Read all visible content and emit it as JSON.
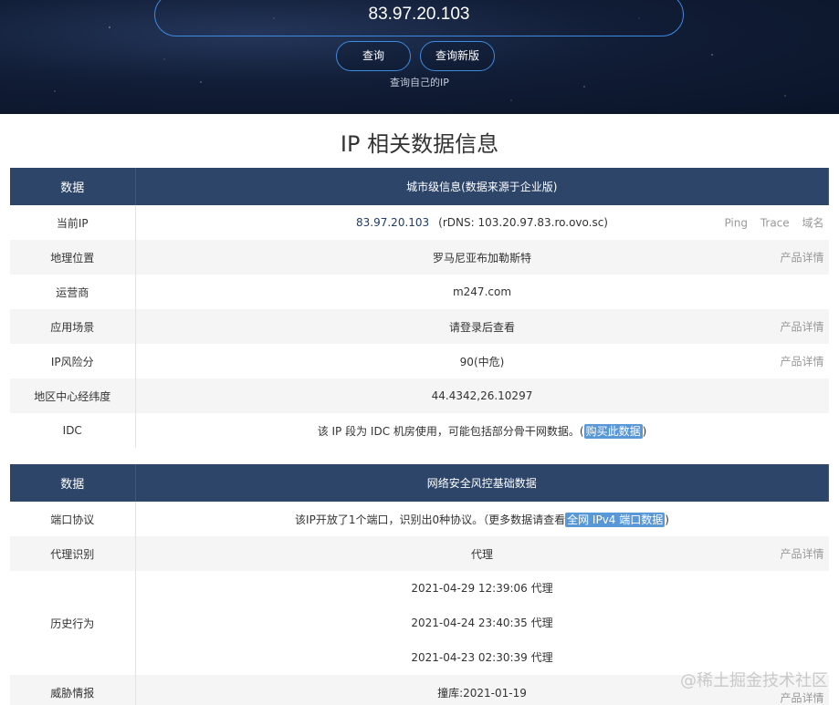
{
  "hero": {
    "ip_value": "83.97.20.103",
    "query_label": "查询",
    "query_new_label": "查询新版",
    "self_link": "查询自己的IP"
  },
  "title": "IP 相关数据信息",
  "table1": {
    "header": {
      "col1": "数据",
      "col2": "城市级信息(数据来源于企业版)"
    },
    "current_ip": {
      "label": "当前IP",
      "ip": "83.97.20.103",
      "rdns": "(rDNS: 103.20.97.83.ro.ovo.sc)",
      "links": [
        "Ping",
        "Trace",
        "域名"
      ]
    },
    "location": {
      "label": "地理位置",
      "value": "罗马尼亚布加勒斯特",
      "link": "产品详情"
    },
    "isp": {
      "label": "运营商",
      "value": "m247.com"
    },
    "scene": {
      "label": "应用场景",
      "value": "请登录后查看",
      "link": "产品详情"
    },
    "risk": {
      "label": "IP风险分",
      "value": "90(中危)",
      "link": "产品详情"
    },
    "latlng": {
      "label": "地区中心经纬度",
      "value": "44.4342,26.10297"
    },
    "idc": {
      "label": "IDC",
      "prefix": "该 IP 段为 IDC 机房使用，可能包括部分骨干网数据。(",
      "link": "购买此数据",
      "suffix": ")"
    }
  },
  "table2": {
    "header": {
      "col1": "数据",
      "col2": "网络安全风控基础数据"
    },
    "ports": {
      "label": "端口协议",
      "prefix": "该IP开放了1个端口，识别出0种协议。（更多数据请查看",
      "link": "全网 IPv4 端口数据",
      "suffix": ")"
    },
    "proxy": {
      "label": "代理识别",
      "value": "代理",
      "link": "产品详情"
    },
    "history": {
      "label": "历史行为",
      "items": [
        "2021-04-29 12:39:06 代理",
        "2021-04-24 23:40:35 代理",
        "2021-04-23 02:30:39 代理"
      ]
    },
    "threat": {
      "label": "威胁情报",
      "value": "撞库:2021-01-19",
      "link": "产品详情"
    }
  },
  "watermark": "@稀土掘金技术社区"
}
